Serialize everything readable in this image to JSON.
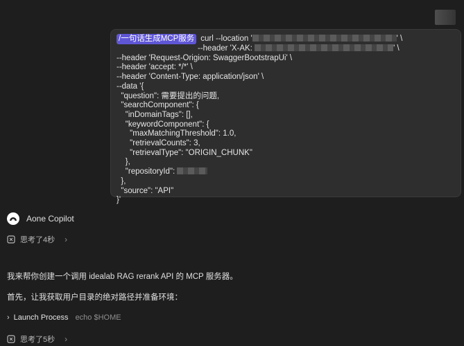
{
  "user_message": {
    "tag": "/一句话生成MCP服务",
    "line1": "curl --location '",
    "line1_end": "' \\",
    "line2": "--header 'X-AK: ",
    "line2_end": "' \\",
    "line3": "--header 'Request-Origion: SwaggerBootstrapUi' \\",
    "line4": "--header 'accept: */*' \\",
    "line5": "--header 'Content-Type: application/json' \\",
    "line6": "--data '{",
    "line7": "  \"question\": 需要提出的问题,",
    "line8": "  \"searchComponent\": {",
    "line9": "    \"inDomainTags\": [],",
    "line10": "    \"keywordComponent\": {",
    "line11": "      \"maxMatchingThreshold\": 1.0,",
    "line12": "      \"retrievalCounts\": 3,",
    "line13": "      \"retrievalType\": \"ORIGIN_CHUNK\"",
    "line14": "    },",
    "line15": "    \"repositoryId\": ",
    "line16": "  },",
    "line17": "  \"source\": \"API\"",
    "line18": "}'"
  },
  "assistant": {
    "name": "Aone Copilot",
    "think1": "思考了4秒",
    "message1": "我来帮你创建一个调用 idealab RAG rerank API 的 MCP 服务器。",
    "message2": "首先，让我获取用户目录的绝对路径并准备环境：",
    "process_label": "Launch Process",
    "process_cmd": "echo $HOME",
    "think2": "思考了5秒"
  }
}
